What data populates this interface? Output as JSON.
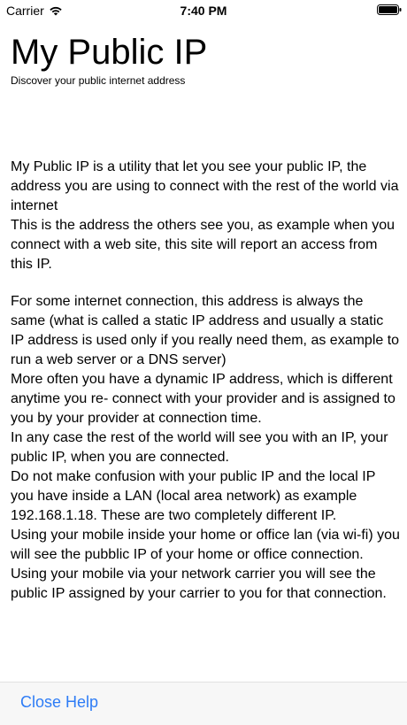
{
  "status_bar": {
    "carrier": "Carrier",
    "time": "7:40 PM"
  },
  "header": {
    "title": "My Public IP",
    "subtitle": "Discover your public internet address"
  },
  "content": {
    "paragraph1": [
      "My Public IP is a utility that let you see your public IP, the address you are using to connect with the rest of the world via internet",
      "This is the address the others see you, as example when you connect with a web site, this site will report an access from this IP."
    ],
    "paragraph2": [
      "For some internet connection, this address is always the same (what is called a static IP address and usually a static IP address is used only if you really need them, as example to run a web server or a DNS server)",
      "More often you have a dynamic IP address, which is different anytime you re- connect with your provider and is assigned to you by your provider at connection time.",
      "In any case the rest of the world will see you with an IP, your public IP, when you are connected.",
      "Do not make confusion with your public IP and the local IP you have inside a LAN (local area network) as example 192.168.1.18. These are two completely different IP.",
      "Using your mobile inside your home or office lan (via wi-fi) you will see the pubblic IP of your home or office connection.",
      "Using your mobile via your network carrier you will see the public IP assigned by your carrier to you for that connection."
    ]
  },
  "footer": {
    "close_label": "Close Help"
  },
  "colors": {
    "link_blue": "#2d7cf6",
    "footer_bg": "#f7f7f7"
  },
  "icons": [
    "wifi-icon",
    "battery-icon"
  ]
}
